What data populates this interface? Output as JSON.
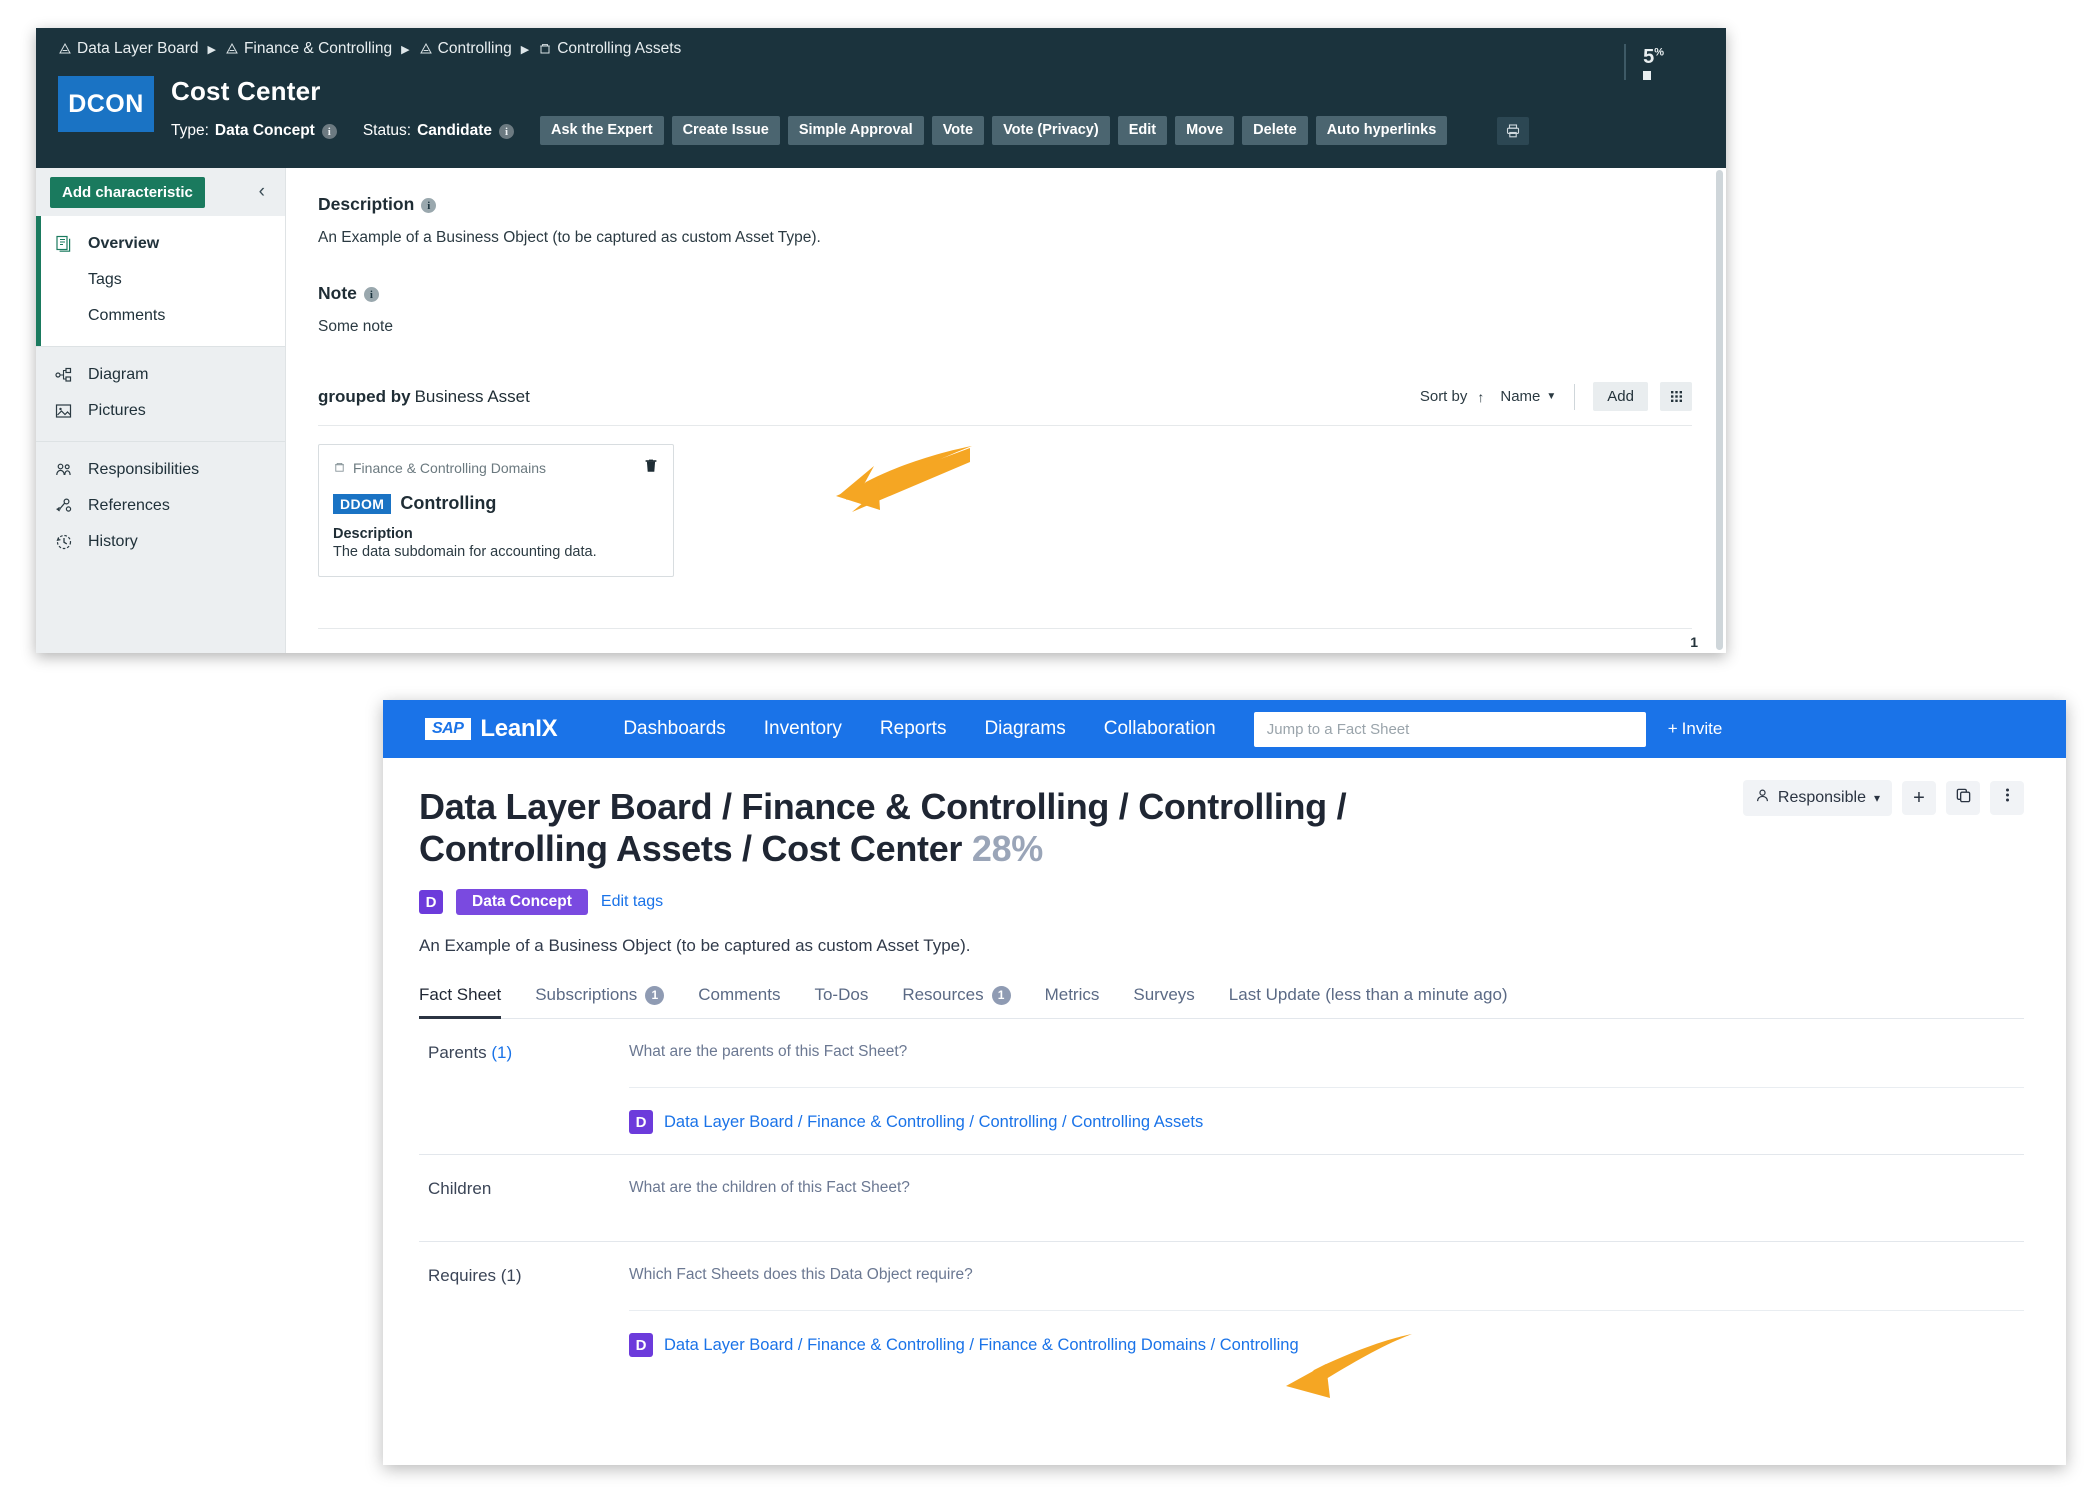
{
  "panel1": {
    "breadcrumb": [
      {
        "label": "Data Layer Board",
        "icon": "domain-icon"
      },
      {
        "label": "Finance & Controlling",
        "icon": "domain-icon"
      },
      {
        "label": "Controlling",
        "icon": "domain-icon"
      },
      {
        "label": "Controlling Assets",
        "icon": "asset-icon"
      }
    ],
    "id_box": "DCON",
    "title": "Cost Center",
    "type_label": "Type:",
    "type_value": "Data Concept",
    "status_label": "Status:",
    "status_value": "Candidate",
    "buttons": [
      "Ask the Expert",
      "Create Issue",
      "Simple Approval",
      "Vote",
      "Vote (Privacy)",
      "Edit",
      "Move",
      "Delete",
      "Auto hyperlinks"
    ],
    "print_icon": "printer-icon",
    "completeness": "5",
    "completeness_unit": "%",
    "sidebar": {
      "add_button": "Add characteristic",
      "collapse_icon": "chevron-left-icon",
      "groups": [
        {
          "active": true,
          "items": [
            {
              "label": "Overview",
              "icon": "pages-icon",
              "selected": true
            },
            {
              "label": "Tags",
              "icon": "",
              "selected": false
            },
            {
              "label": "Comments",
              "icon": "",
              "selected": false
            }
          ]
        },
        {
          "active": false,
          "items": [
            {
              "label": "Diagram",
              "icon": "diagram-icon",
              "selected": false
            },
            {
              "label": "Pictures",
              "icon": "picture-icon",
              "selected": false
            }
          ]
        },
        {
          "active": false,
          "items": [
            {
              "label": "Responsibilities",
              "icon": "people-icon",
              "selected": false
            },
            {
              "label": "References",
              "icon": "reference-icon",
              "selected": false
            },
            {
              "label": "History",
              "icon": "history-icon",
              "selected": false
            }
          ]
        }
      ]
    },
    "main": {
      "description_heading": "Description",
      "description_text": "An Example of a Business Object (to be captured as custom Asset Type).",
      "note_heading": "Note",
      "note_text": "Some note",
      "grouped_by_label": "grouped by",
      "grouped_by_value": "Business Asset",
      "sort_by_label": "Sort by",
      "sort_direction_icon": "arrow-up-icon",
      "sort_field": "Name",
      "add_label": "Add",
      "grid_icon": "grid-view-icon",
      "card": {
        "source_label": "Finance & Controlling Domains",
        "source_icon": "asset-icon",
        "delete_icon": "trash-icon",
        "badge": "DDOM",
        "title": "Controlling",
        "description_heading": "Description",
        "description_text": "The data subdomain for accounting data."
      },
      "page_number": "1"
    }
  },
  "panel2": {
    "brand_sap": "SAP",
    "brand_name": "LeanIX",
    "nav": [
      "Dashboards",
      "Inventory",
      "Reports",
      "Diagrams",
      "Collaboration"
    ],
    "search_placeholder": "Jump to a Fact Sheet",
    "search_value": "",
    "invite_label": "Invite",
    "invite_icon": "plus-icon",
    "title": "Data Layer Board / Finance & Controlling / Controlling / Controlling Assets / Cost Center",
    "completeness": "28%",
    "tag_initial": "D",
    "tag_label": "Data Concept",
    "edit_tags_label": "Edit tags",
    "description": "An Example of a Business Object (to be captured as custom Asset Type).",
    "right_controls": {
      "responsible_label": "Responsible",
      "responsible_icon": "user-icon",
      "chevron_icon": "chevron-down-icon",
      "add_icon": "plus-icon",
      "copy_icon": "copy-icon",
      "more_icon": "kebab-menu-icon"
    },
    "tabs": [
      {
        "label": "Fact Sheet",
        "badge": "",
        "active": true
      },
      {
        "label": "Subscriptions",
        "badge": "1",
        "active": false
      },
      {
        "label": "Comments",
        "badge": "",
        "active": false
      },
      {
        "label": "To-Dos",
        "badge": "",
        "active": false
      },
      {
        "label": "Resources",
        "badge": "1",
        "active": false
      },
      {
        "label": "Metrics",
        "badge": "",
        "active": false
      },
      {
        "label": "Surveys",
        "badge": "",
        "active": false
      },
      {
        "label": "Last Update (less than a minute ago)",
        "badge": "",
        "active": false
      }
    ],
    "sections": [
      {
        "label": "Parents",
        "count": "(1)",
        "question": "What are the parents of this Fact Sheet?",
        "relations": [
          {
            "badge": "D",
            "label": "Data Layer Board / Finance & Controlling / Controlling / Controlling Assets"
          }
        ]
      },
      {
        "label": "Children",
        "count": "",
        "question": "What are the children of this Fact Sheet?",
        "relations": []
      },
      {
        "label": "Requires (1)",
        "count": "",
        "question": "Which Fact Sheets does this Data Object require?",
        "relations": [
          {
            "badge": "D",
            "label": "Data Layer Board / Finance & Controlling / Finance & Controlling Domains / Controlling"
          }
        ]
      }
    ]
  },
  "colors": {
    "header_dark": "#1b333d",
    "accent_green": "#1a7a5e",
    "accent_blue": "#1a73c4",
    "leanix_blue": "#1a73e8",
    "tag_purple": "#7a4ae0",
    "arrow_orange": "#F5A623"
  }
}
